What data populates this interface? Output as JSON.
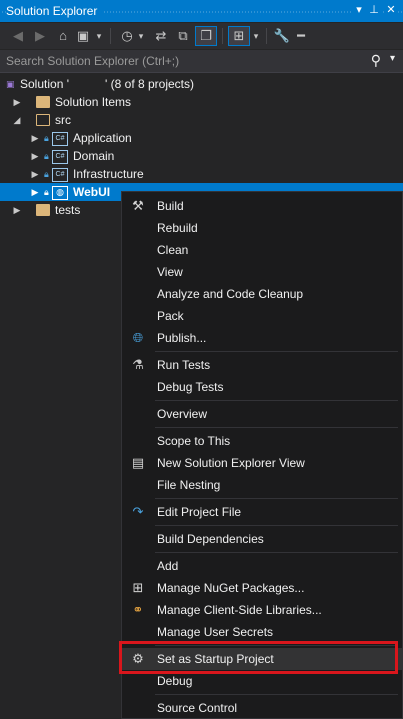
{
  "window": {
    "title": "Solution Explorer"
  },
  "titlebar_icons": {
    "dropdown": "▾",
    "pin": "⊥",
    "close": "✕"
  },
  "search": {
    "placeholder": "Search Solution Explorer (Ctrl+;)"
  },
  "tree": {
    "solution": {
      "name": "Solution '",
      "name_end": "'",
      "info": "(8 of 8 projects)"
    },
    "solution_items": "Solution Items",
    "src": "src",
    "application": "Application",
    "domain": "Domain",
    "infrastructure": "Infrastructure",
    "webui": "WebUI",
    "tests": "tests",
    "csharp_badge": "C#"
  },
  "menu": {
    "build": "Build",
    "rebuild": "Rebuild",
    "clean": "Clean",
    "view": "View",
    "analyze": "Analyze and Code Cleanup",
    "pack": "Pack",
    "publish": "Publish...",
    "run_tests": "Run Tests",
    "debug_tests": "Debug Tests",
    "overview": "Overview",
    "scope": "Scope to This",
    "new_view": "New Solution Explorer View",
    "file_nesting": "File Nesting",
    "edit_project": "Edit Project File",
    "build_deps": "Build Dependencies",
    "add": "Add",
    "nuget": "Manage NuGet Packages...",
    "client_libs": "Manage Client-Side Libraries...",
    "user_secrets": "Manage User Secrets",
    "startup": "Set as Startup Project",
    "debug": "Debug",
    "source_control": "Source Control"
  },
  "colors": {
    "accent": "#007acc",
    "highlight_border": "#d9161c",
    "background": "#252526",
    "menu_bg": "#1b1b1c"
  }
}
